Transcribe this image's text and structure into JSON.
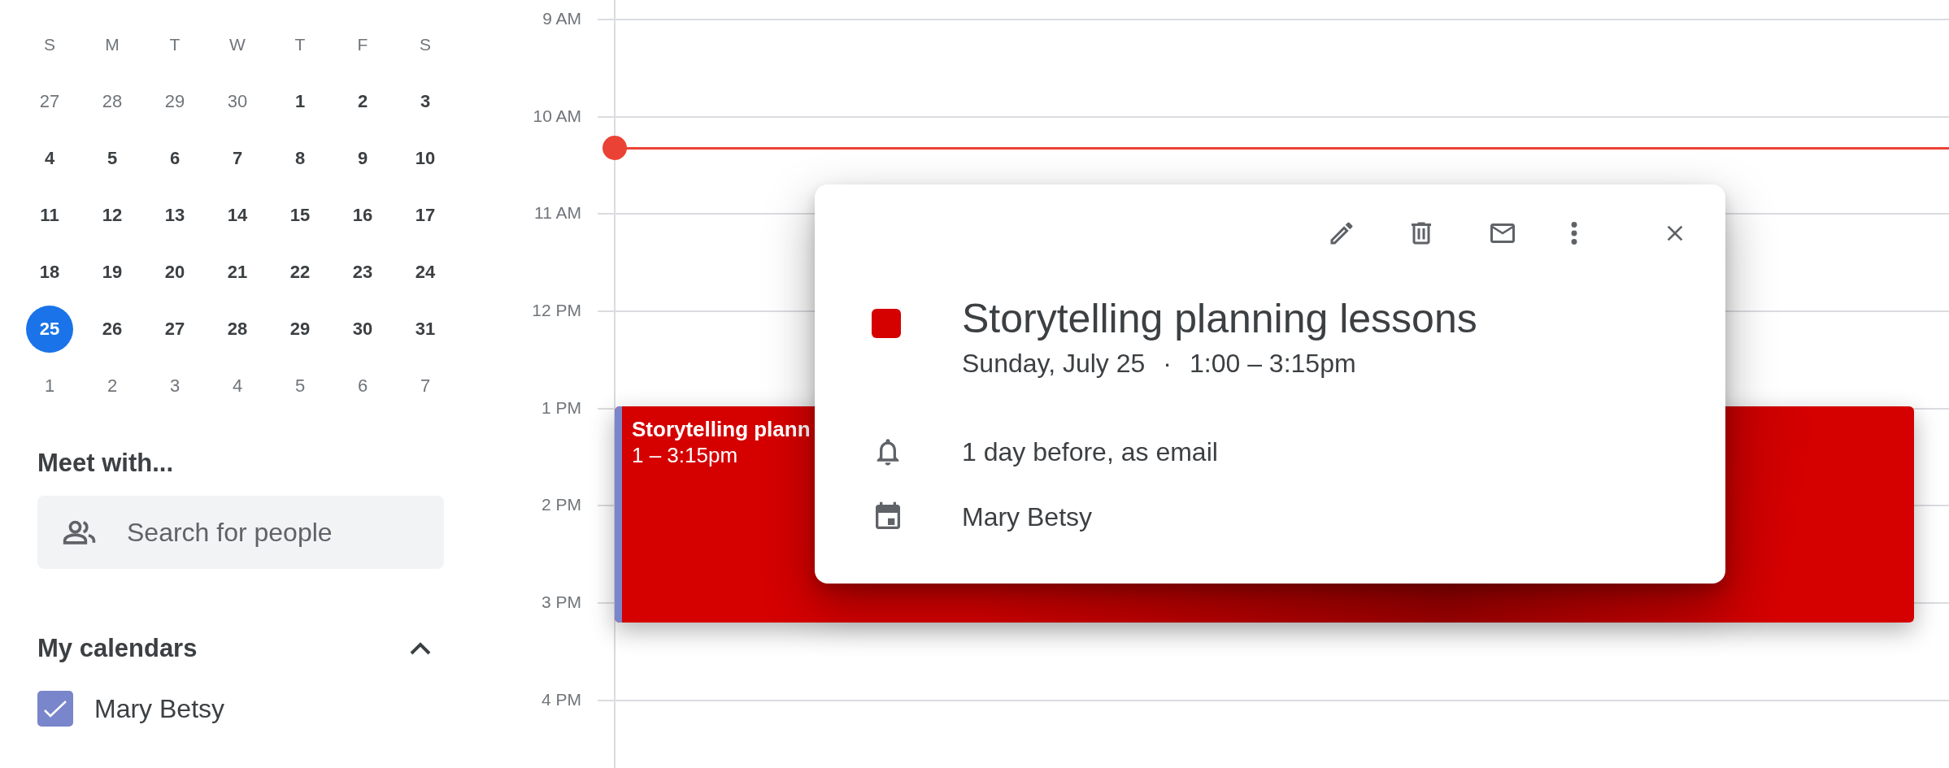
{
  "mini_calendar": {
    "weekdays": [
      "S",
      "M",
      "T",
      "W",
      "T",
      "F",
      "S"
    ],
    "weeks": [
      [
        {
          "label": "27",
          "in_month": false,
          "selected": false
        },
        {
          "label": "28",
          "in_month": false,
          "selected": false
        },
        {
          "label": "29",
          "in_month": false,
          "selected": false
        },
        {
          "label": "30",
          "in_month": false,
          "selected": false
        },
        {
          "label": "1",
          "in_month": true,
          "selected": false
        },
        {
          "label": "2",
          "in_month": true,
          "selected": false
        },
        {
          "label": "3",
          "in_month": true,
          "selected": false
        }
      ],
      [
        {
          "label": "4",
          "in_month": true,
          "selected": false
        },
        {
          "label": "5",
          "in_month": true,
          "selected": false
        },
        {
          "label": "6",
          "in_month": true,
          "selected": false
        },
        {
          "label": "7",
          "in_month": true,
          "selected": false
        },
        {
          "label": "8",
          "in_month": true,
          "selected": false
        },
        {
          "label": "9",
          "in_month": true,
          "selected": false
        },
        {
          "label": "10",
          "in_month": true,
          "selected": false
        }
      ],
      [
        {
          "label": "11",
          "in_month": true,
          "selected": false
        },
        {
          "label": "12",
          "in_month": true,
          "selected": false
        },
        {
          "label": "13",
          "in_month": true,
          "selected": false
        },
        {
          "label": "14",
          "in_month": true,
          "selected": false
        },
        {
          "label": "15",
          "in_month": true,
          "selected": false
        },
        {
          "label": "16",
          "in_month": true,
          "selected": false
        },
        {
          "label": "17",
          "in_month": true,
          "selected": false
        }
      ],
      [
        {
          "label": "18",
          "in_month": true,
          "selected": false
        },
        {
          "label": "19",
          "in_month": true,
          "selected": false
        },
        {
          "label": "20",
          "in_month": true,
          "selected": false
        },
        {
          "label": "21",
          "in_month": true,
          "selected": false
        },
        {
          "label": "22",
          "in_month": true,
          "selected": false
        },
        {
          "label": "23",
          "in_month": true,
          "selected": false
        },
        {
          "label": "24",
          "in_month": true,
          "selected": false
        }
      ],
      [
        {
          "label": "25",
          "in_month": true,
          "selected": true
        },
        {
          "label": "26",
          "in_month": true,
          "selected": false
        },
        {
          "label": "27",
          "in_month": true,
          "selected": false
        },
        {
          "label": "28",
          "in_month": true,
          "selected": false
        },
        {
          "label": "29",
          "in_month": true,
          "selected": false
        },
        {
          "label": "30",
          "in_month": true,
          "selected": false
        },
        {
          "label": "31",
          "in_month": true,
          "selected": false
        }
      ],
      [
        {
          "label": "1",
          "in_month": false,
          "selected": false
        },
        {
          "label": "2",
          "in_month": false,
          "selected": false
        },
        {
          "label": "3",
          "in_month": false,
          "selected": false
        },
        {
          "label": "4",
          "in_month": false,
          "selected": false
        },
        {
          "label": "5",
          "in_month": false,
          "selected": false
        },
        {
          "label": "6",
          "in_month": false,
          "selected": false
        },
        {
          "label": "7",
          "in_month": false,
          "selected": false
        }
      ]
    ]
  },
  "meet_with": {
    "heading": "Meet with...",
    "search": {
      "placeholder": "Search for people"
    }
  },
  "my_calendars": {
    "heading": "My calendars",
    "expanded": true,
    "items": [
      {
        "name": "Mary Betsy",
        "checked": true,
        "color": "#7986cb"
      }
    ]
  },
  "day_view": {
    "hours": [
      "9 AM",
      "10 AM",
      "11 AM",
      "12 PM",
      "1 PM",
      "2 PM",
      "3 PM",
      "4 PM"
    ],
    "event": {
      "title": "Storytelling plann",
      "time": "1 – 3:15pm",
      "color": "#d50000"
    }
  },
  "event_popup": {
    "title": "Storytelling planning lessons",
    "color": "#d50000",
    "date": "Sunday, July 25",
    "separator": "·",
    "time": "1:00 – 3:15pm",
    "details": [
      {
        "kind": "reminder",
        "text": "1 day before, as email"
      },
      {
        "kind": "calendar",
        "text": "Mary Betsy"
      }
    ]
  }
}
